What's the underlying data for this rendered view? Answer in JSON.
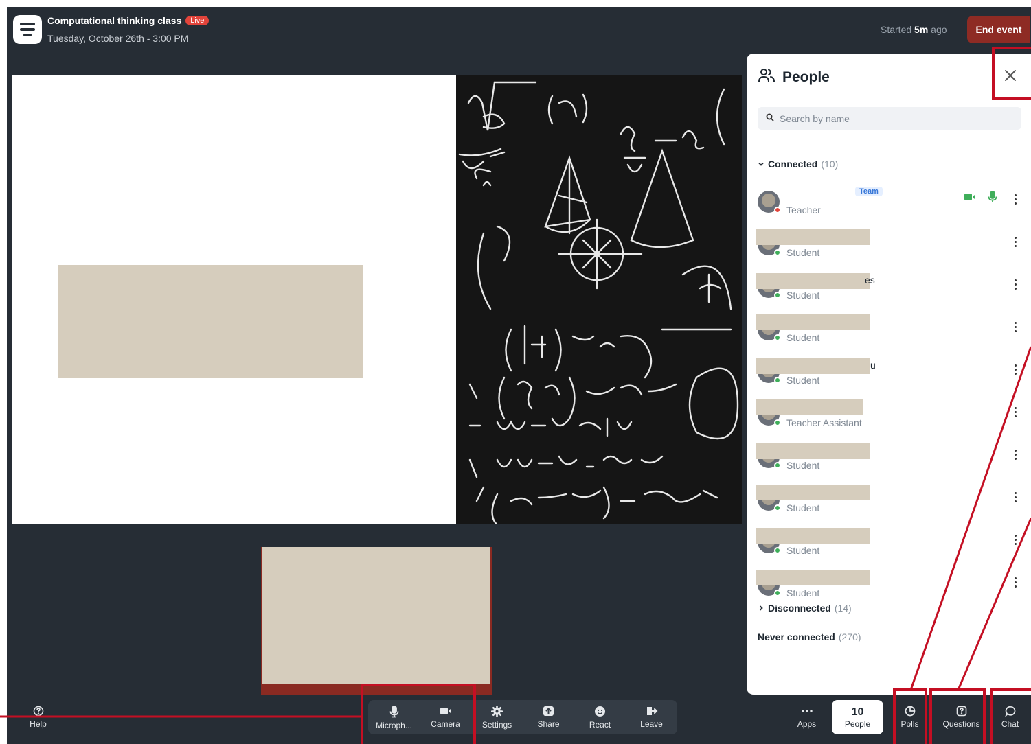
{
  "header": {
    "class_title": "Computational thinking class",
    "live_badge": "Live",
    "date_time": "Tuesday, October 26th - 3:00 PM",
    "started_prefix": "Started",
    "started_value": "5m",
    "started_suffix": "ago",
    "end_event_label": "End event"
  },
  "people_panel": {
    "title": "People",
    "search_placeholder": "Search by name",
    "connected_label": "Connected",
    "connected_count": "(10)",
    "disconnected_label": "Disconnected",
    "disconnected_count": "(14)",
    "never_connected_label": "Never connected",
    "never_connected_count": "(270)",
    "team_badge": "Team",
    "participants": [
      {
        "role": "Teacher",
        "name_tail": ""
      },
      {
        "role": "Student",
        "name_tail": ""
      },
      {
        "role": "Student",
        "name_tail": "es"
      },
      {
        "role": "Student",
        "name_tail": ""
      },
      {
        "role": "Student",
        "name_tail": "u"
      },
      {
        "role": "Teacher Assistant",
        "name_tail": ""
      },
      {
        "role": "Student",
        "name_tail": ""
      },
      {
        "role": "Student",
        "name_tail": ""
      },
      {
        "role": "Student",
        "name_tail": ""
      },
      {
        "role": "Student",
        "name_tail": ""
      }
    ]
  },
  "controls": {
    "help": "Help",
    "microphone": "Microph...",
    "camera": "Camera",
    "settings": "Settings",
    "share": "Share",
    "react": "React",
    "leave": "Leave",
    "apps": "Apps",
    "people_count": "10",
    "people": "People",
    "polls": "Polls",
    "questions": "Questions",
    "chat": "Chat"
  },
  "colors": {
    "background": "#262d35",
    "live": "#e2443b",
    "end_event": "#8e2b24",
    "online": "#3fae5a",
    "annotation": "#c40f23"
  }
}
